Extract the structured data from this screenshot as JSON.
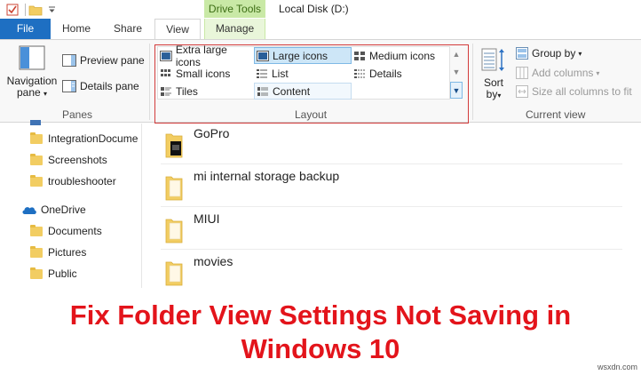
{
  "titlebar": {
    "contextual_tab_group": "Drive Tools",
    "window_title": "Local Disk (D:)"
  },
  "tabs": {
    "file": "File",
    "home": "Home",
    "share": "Share",
    "view": "View",
    "manage": "Manage"
  },
  "ribbon": {
    "panes": {
      "label": "Panes",
      "navigation_pane_line1": "Navigation",
      "navigation_pane_line2": "pane",
      "preview_pane": "Preview pane",
      "details_pane": "Details pane"
    },
    "layout": {
      "label": "Layout",
      "items": {
        "extra_large_icons": "Extra large icons",
        "large_icons": "Large icons",
        "medium_icons": "Medium icons",
        "small_icons": "Small icons",
        "list": "List",
        "details": "Details",
        "tiles": "Tiles",
        "content": "Content"
      },
      "selected": "Large icons"
    },
    "current_view": {
      "label": "Current view",
      "sort_by_line1": "Sort",
      "sort_by_line2": "by",
      "group_by": "Group by",
      "add_columns": "Add columns",
      "size_columns": "Size all columns to fit"
    }
  },
  "nav": {
    "items": [
      {
        "label": "IntegrationDocume"
      },
      {
        "label": "Screenshots"
      },
      {
        "label": "troubleshooter"
      },
      {
        "label": "OneDrive"
      },
      {
        "label": "Documents"
      },
      {
        "label": "Pictures"
      },
      {
        "label": "Public"
      }
    ]
  },
  "files": [
    {
      "name": "GoPro"
    },
    {
      "name": "mi internal storage backup"
    },
    {
      "name": "MIUI"
    },
    {
      "name": "movies"
    }
  ],
  "headline": {
    "line1": "Fix Folder View Settings Not Saving in",
    "line2": "Windows 10"
  },
  "watermark": "wsxdn.com",
  "colors": {
    "file_tab": "#1e6fc2",
    "drive_tools": "#c9e9a6",
    "highlight_box": "#d23b3b",
    "headline": "#e3141b"
  }
}
